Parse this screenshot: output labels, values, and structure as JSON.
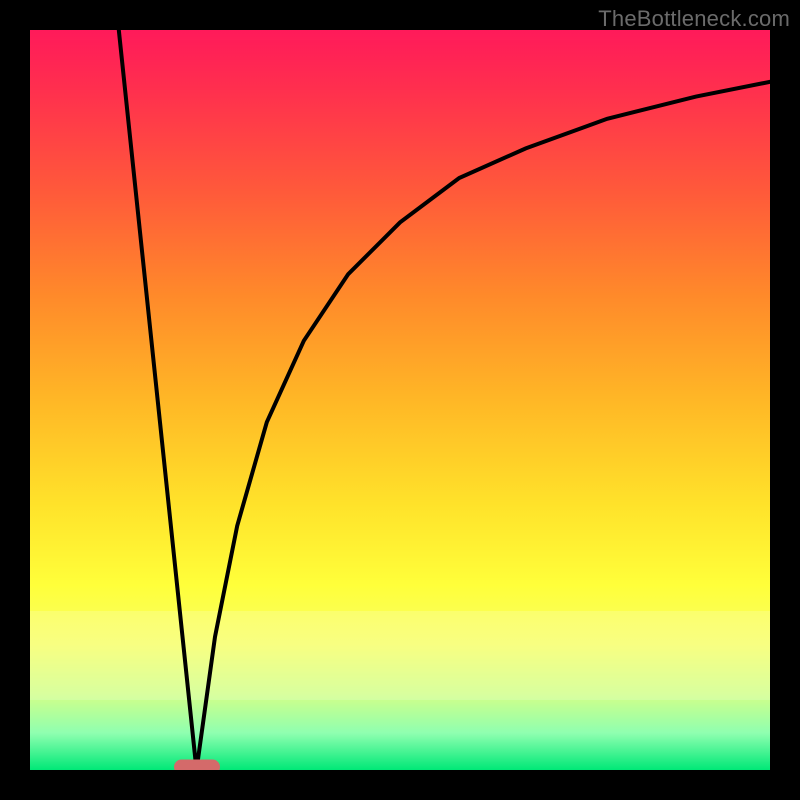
{
  "watermark": "TheBottleneck.com",
  "chart_data": {
    "type": "line",
    "title": "",
    "xlabel": "",
    "ylabel": "",
    "xlim": [
      0,
      100
    ],
    "ylim": [
      0,
      100
    ],
    "grid": false,
    "legend": false,
    "series": [
      {
        "name": "left_line",
        "x": [
          12,
          22.5
        ],
        "values": [
          100,
          0
        ]
      },
      {
        "name": "right_curve",
        "x": [
          22.5,
          25,
          28,
          32,
          37,
          43,
          50,
          58,
          67,
          78,
          90,
          100
        ],
        "values": [
          0,
          18,
          33,
          47,
          58,
          67,
          74,
          80,
          84,
          88,
          91,
          93
        ]
      }
    ],
    "marker": {
      "x_percent": 22.5,
      "y_percent": 0
    },
    "highlight_band": {
      "y_from_percent": 78.5,
      "height_percent": 12
    }
  }
}
